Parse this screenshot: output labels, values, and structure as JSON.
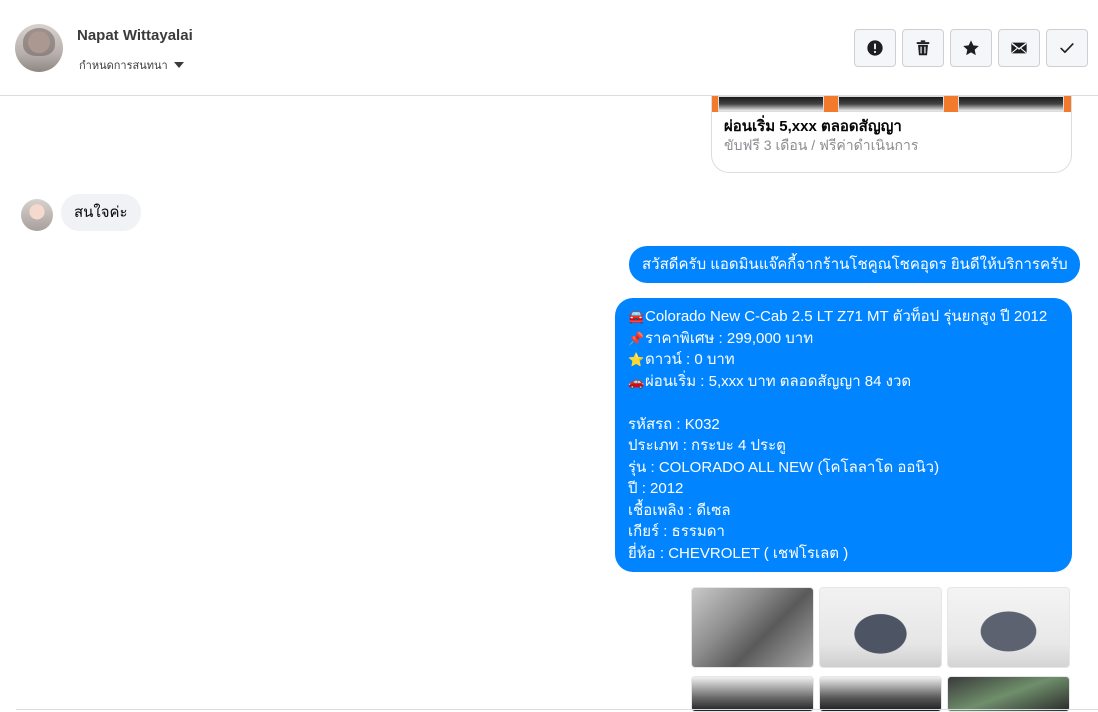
{
  "header": {
    "contact_name": "Napat Wittayalai",
    "conversation_setting": "กำหนดการสนทนา",
    "actions": [
      {
        "icon": "alert-icon"
      },
      {
        "icon": "trash-icon"
      },
      {
        "icon": "star-icon"
      },
      {
        "icon": "mail-icon"
      },
      {
        "icon": "check-icon"
      }
    ]
  },
  "messages": {
    "card_preview": {
      "title": "ผ่อนเริ่ม 5,xxx ตลอดสัญญา",
      "subtitle": "ขับฟรี 3 เดือน / ฟรีค่าดำเนินการ"
    },
    "incoming": "สนใจค่ะ",
    "greeting": "สวัสดีครับ แอดมินแจ๊คกี้จากร้านโชคูณโชคอุดร ยินดีให้บริการครับ",
    "detail": {
      "line_1": "Colorado New C-Cab 2.5 LT Z71 MT ตัวท็อป รุ่นยกสูง ปี 2012",
      "line_2": "ราคาพิเศษ : 299,000 บาท",
      "line_3": "ดาวน์ : 0 บาท",
      "line_4": "ผ่อนเริ่ม : 5,xxx บาท ตลอดสัญญา 84 งวด",
      "line_5": "รหัสรถ : K032",
      "line_6": "ประเภท : กระบะ 4 ประตู",
      "line_7": "รุ่น : COLORADO ALL NEW (โคโลลาโด ออนิว)",
      "line_8": "ปี : 2012",
      "line_9": "เชื้อเพลิง : ดีเซล",
      "line_10": "เกียร์ : ธรรมดา",
      "line_11": "ยี่ห้อ : CHEVROLET ( เชฟโรเลต )"
    },
    "emoji": {
      "car": "🚘",
      "pin": "📌",
      "star": "⭐",
      "car_small": "🚗"
    }
  },
  "colors": {
    "outgoing_bubble": "#0084ff",
    "incoming_bubble": "#f0f2f5",
    "card_strip": "#f27a2c"
  }
}
